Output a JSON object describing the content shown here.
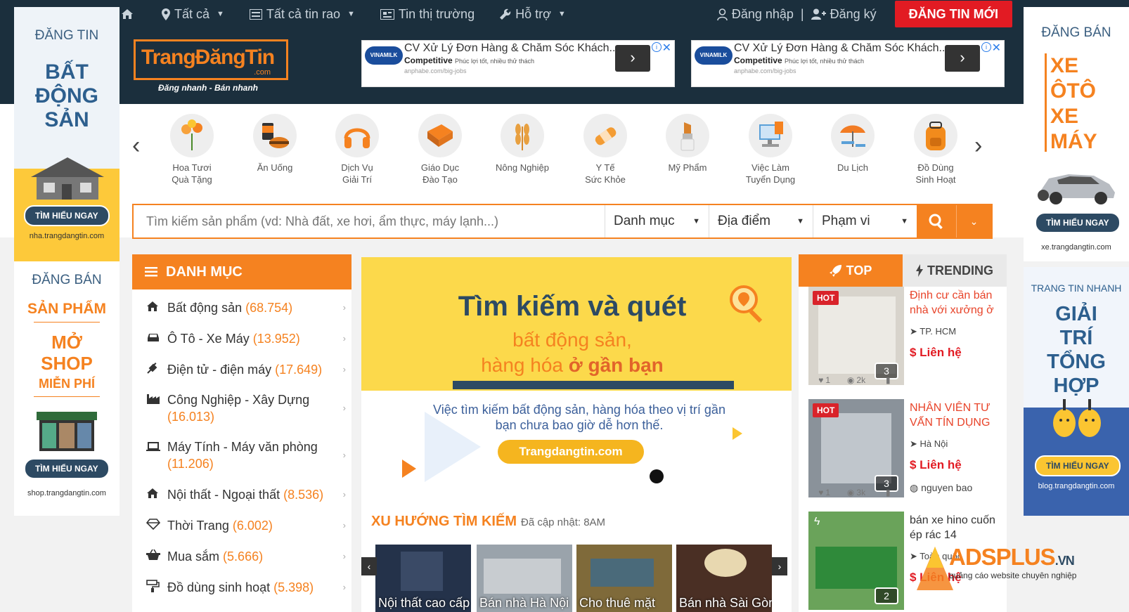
{
  "nav": {
    "items": [
      {
        "label": "",
        "icon": "home-icon"
      },
      {
        "label": "Tất cả",
        "icon": "map-marker-icon"
      },
      {
        "label": "Tất cả tin rao",
        "icon": "list-icon"
      },
      {
        "label": "Tin thị trường",
        "icon": "newspaper-icon"
      },
      {
        "label": "Hỗ trợ",
        "icon": "wrench-icon"
      }
    ],
    "login": "Đăng nhập",
    "separator": "|",
    "register": "Đăng ký",
    "post_button": "ĐĂNG TIN MỚI"
  },
  "logo": {
    "name": "TrangĐăngTin",
    "suffix": ".com",
    "slogan": "Đăng nhanh - Bán nhanh"
  },
  "top_ads": [
    {
      "badge": "VINAMILK",
      "title": "CV Xử Lý Đơn Hàng & Chăm Sóc Khách...",
      "bold": "Competitive",
      "desc": "Phúc lợi tốt, nhiều thử thách",
      "url": "anphabe.com/big-jobs",
      "arrow": "›"
    },
    {
      "badge": "VINAMILK",
      "title": "CV Xử Lý Đơn Hàng & Chăm Sóc Khách...",
      "bold": "Competitive",
      "desc": "Phúc lợi tốt, nhiều thử thách",
      "url": "anphabe.com/big-jobs",
      "arrow": "›"
    }
  ],
  "left_banner_1": {
    "top": "ĐĂNG TIN",
    "big": [
      "BẤT",
      "ĐỘNG",
      "SẢN"
    ],
    "button": "TÌM HIỂU NGAY",
    "url": "nha.trangdangtin.com"
  },
  "left_banner_2": {
    "top": "ĐĂNG BÁN",
    "line1": "SẢN PHẨM",
    "line2": "MỞ",
    "line3": "SHOP",
    "line4": "MIỄN PHÍ",
    "button": "TÌM HIỂU NGAY",
    "url": "shop.trangdangtin.com"
  },
  "right_banner_1": {
    "top": "ĐĂNG BÁN",
    "big": [
      "XE",
      "ÔTÔ",
      "XE",
      "MÁY"
    ],
    "button": "TÌM HIỂU NGAY",
    "url": "xe.trangdangtin.com"
  },
  "right_banner_2": {
    "top": "TRANG TIN NHANH",
    "big": [
      "GIẢI",
      "TRÍ",
      "TỔNG",
      "HỢP"
    ],
    "button": "TÌM HIỂU NGAY",
    "url": "blog.trangdangtin.com"
  },
  "categories": [
    {
      "line1": "Hoa Tươi",
      "line2": "Quà Tặng",
      "color": "#f7a23b"
    },
    {
      "line1": "Ăn Uống",
      "line2": "",
      "color": "#e07b1f"
    },
    {
      "line1": "Dịch Vụ",
      "line2": "Giải Trí",
      "color": "#f58220"
    },
    {
      "line1": "Giáo Dục",
      "line2": "Đào Tạo",
      "color": "#f0882a"
    },
    {
      "line1": "Nông Nghiệp",
      "line2": "",
      "color": "#e8a040"
    },
    {
      "line1": "Y Tế",
      "line2": "Sức Khỏe",
      "color": "#f39c34"
    },
    {
      "line1": "Mỹ Phẩm",
      "line2": "",
      "color": "#d9822b"
    },
    {
      "line1": "Việc Làm",
      "line2": "Tuyển Dụng",
      "color": "#5aa0d8"
    },
    {
      "line1": "Du Lịch",
      "line2": "",
      "color": "#f27c24"
    },
    {
      "line1": "Đồ Dùng",
      "line2": "Sinh Hoạt",
      "color": "#f28b1c"
    }
  ],
  "search": {
    "placeholder": "Tìm kiếm sản phẩm (vd: Nhà đất, xe hơi, ẩm thực, máy lạnh...)",
    "category": "Danh mục",
    "location": "Địa điểm",
    "scope": "Phạm vi"
  },
  "danh_muc": {
    "title": "DANH MỤC",
    "items": [
      {
        "label": "Bất động sản",
        "count": "(68.754)",
        "icon": "home-icon"
      },
      {
        "label": "Ô Tô - Xe Máy",
        "count": "(13.952)",
        "icon": "car-icon"
      },
      {
        "label": "Điện tử - điện máy",
        "count": "(17.649)",
        "icon": "plug-icon"
      },
      {
        "label": "Công Nghiệp - Xây Dựng",
        "count": "(16.013)",
        "icon": "industry-icon"
      },
      {
        "label": "Máy Tính - Máy văn phòng",
        "count": "(11.206)",
        "icon": "laptop-icon"
      },
      {
        "label": "Nội thất - Ngoại thất",
        "count": "(8.536)",
        "icon": "home-icon"
      },
      {
        "label": "Thời Trang",
        "count": "(6.002)",
        "icon": "diamond-icon"
      },
      {
        "label": "Mua sắm",
        "count": "(5.666)",
        "icon": "basket-icon"
      },
      {
        "label": "Đồ dùng sinh hoạt",
        "count": "(5.398)",
        "icon": "paint-icon"
      }
    ]
  },
  "banner": {
    "headline": "Tìm kiếm và quét",
    "sub1": "bất động sản,",
    "sub2": "hàng hóa",
    "sub3": "ở gần bạn",
    "text1": "Việc tìm kiếm bất động sản, hàng hóa theo vị trí gần",
    "text2": "bạn chưa bao giờ dễ hơn thế.",
    "cta": "Trangdangtin.com"
  },
  "trend": {
    "title": "XU HƯỚNG TÌM KIẾM",
    "updated": "Đã cập nhật: 8AM",
    "items": [
      {
        "label": "Nội thất cao cấp",
        "color": "#24324a"
      },
      {
        "label": "Bán nhà Hà Nội",
        "color": "#9aa3ab"
      },
      {
        "label": "Cho thuê mặt",
        "color": "#7f6a3a"
      },
      {
        "label": "Bán nhà Sài Gòn",
        "color": "#4a2f24"
      }
    ]
  },
  "right_panel": {
    "tab_top": "TOP",
    "tab_trending": "TRENDING",
    "posts": [
      {
        "hot": "HOT",
        "title": "Định cư cần bán nhà với xưởng ở",
        "location": "TP. HCM",
        "price": "$ Liên hệ",
        "images": "3",
        "likes": "1",
        "views": "2k",
        "user": "",
        "img_color": "#d8d4cc"
      },
      {
        "hot": "HOT",
        "title": "NHÂN VIÊN TƯ VẤN TÍN DỤNG",
        "location": "Hà Nội",
        "price": "$ Liên hệ",
        "images": "3",
        "likes": "1",
        "views": "3k",
        "user": "nguyen bao",
        "img_color": "#8a929a"
      },
      {
        "hot": "",
        "title": "bán xe hino cuốn ép rác 14",
        "location": "Toàn quốc",
        "price": "$ Liên hệ",
        "images": "2",
        "likes": "",
        "views": "",
        "user": "",
        "img_color": "#6aa35a"
      }
    ]
  },
  "watermark": {
    "name": "ADSPLUS",
    "tld": ".VN",
    "tagline": "quảng cáo website chuyên nghiệp"
  }
}
